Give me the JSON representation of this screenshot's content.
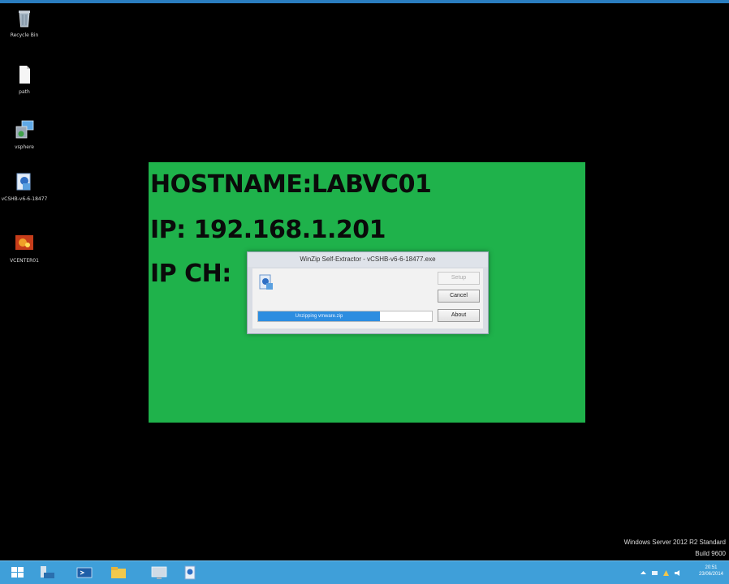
{
  "desktop_icons": [
    {
      "label": "Recycle Bin",
      "icon": "recycle-bin-icon"
    },
    {
      "label": "path",
      "icon": "text-file-icon"
    },
    {
      "label": "vsphere",
      "icon": "installer-icon"
    },
    {
      "label": "vCSHB-v6-6-18477",
      "icon": "winzip-self-extractor-icon"
    },
    {
      "label": "VCENTER01",
      "icon": "vcenter-icon"
    }
  ],
  "bginfo": {
    "hostname": "HOSTNAME:LABVC01",
    "ip": "IP: 192.168.1.201",
    "ip_ch": "IP CH:"
  },
  "dialog": {
    "title": "WinZip Self-Extractor - vCSHB-v6-6-18477.exe",
    "setup_label": "Setup",
    "cancel_label": "Cancel",
    "about_label": "About",
    "progress_text": "Unzipping vmware.zip",
    "progress_fraction": 0.7
  },
  "watermark": {
    "edition": "Windows Server 2012 R2 Standard",
    "build": "Build 9600"
  },
  "taskbar": {
    "items": [
      "start-icon",
      "server-manager-icon",
      "powershell-icon",
      "file-explorer-icon",
      "remote-desktop-icon",
      "winzip-taskbar-icon"
    ],
    "time": "20:51",
    "date": "23/06/2014"
  },
  "colors": {
    "bginfo_background": "#1fb24b",
    "taskbar": "#3f9fd9",
    "progress_fill": "#2d8de0"
  }
}
